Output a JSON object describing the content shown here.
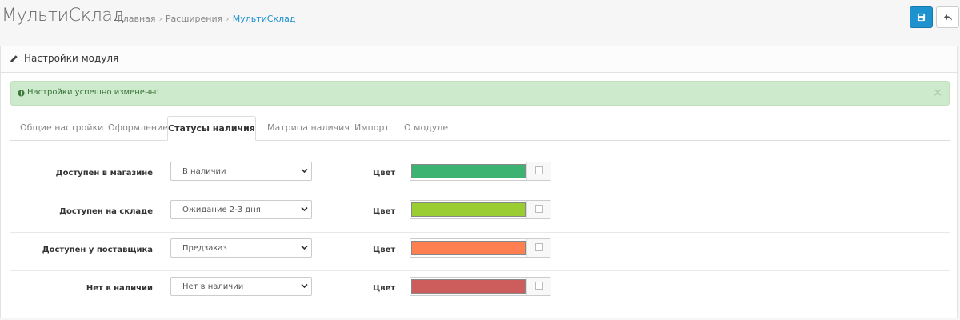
{
  "header": {
    "title": "МультиСклад",
    "breadcrumb": [
      "Главная",
      "Расширения",
      "МультиСклад"
    ],
    "separator": "›"
  },
  "panel": {
    "title": "Настройки модуля"
  },
  "alert": {
    "text": "Настройки успешно изменены!",
    "close": "×"
  },
  "tabs": [
    {
      "label": "Общие настройки"
    },
    {
      "label": "Оформление"
    },
    {
      "label": "Статусы наличия",
      "active": true
    },
    {
      "label": "Матрица наличия"
    },
    {
      "label": "Импорт"
    },
    {
      "label": "О модуле"
    }
  ],
  "statuses": [
    {
      "label": "Доступен в магазине",
      "value": "В наличии",
      "color_label": "Цвет",
      "color": "#3cb371"
    },
    {
      "label": "Доступен на складе",
      "value": "Ожидание 2-3 дня",
      "color_label": "Цвет",
      "color": "#9acd32"
    },
    {
      "label": "Доступен у поставщика",
      "value": "Предзаказ",
      "color_label": "Цвет",
      "color": "#ff7f50"
    },
    {
      "label": "Нет в наличии",
      "value": "Нет в наличии",
      "color_label": "Цвет",
      "color": "#cd5c5c"
    }
  ],
  "colors": {
    "accent": "#1e91cf",
    "success_bg": "#cdeacc",
    "success_text": "#3c763d"
  },
  "icons": {
    "save": "save-icon",
    "back": "reply-icon",
    "panel": "pencil-icon",
    "alert": "exclamation-circle-icon",
    "select": "chevron-down-icon"
  }
}
